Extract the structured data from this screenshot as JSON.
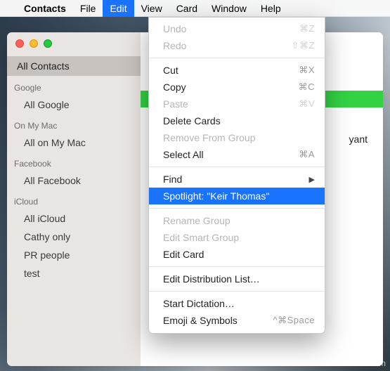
{
  "menubar": {
    "apple": "",
    "app": "Contacts",
    "items": [
      "File",
      "Edit",
      "View",
      "Card",
      "Window",
      "Help"
    ],
    "active_index": 1
  },
  "sidebar": {
    "selected": "All Contacts",
    "groups": [
      {
        "label": "Google",
        "items": [
          "All Google"
        ]
      },
      {
        "label": "On My Mac",
        "items": [
          "All on My Mac"
        ]
      },
      {
        "label": "Facebook",
        "items": [
          "All Facebook"
        ]
      },
      {
        "label": "iCloud",
        "items": [
          "All iCloud",
          "Cathy only",
          "PR people",
          "test"
        ]
      }
    ]
  },
  "content": {
    "visible_fragment": "yant"
  },
  "menu": {
    "rows": [
      {
        "label": "Undo",
        "shortcut": "⌘Z",
        "disabled": true
      },
      {
        "label": "Redo",
        "shortcut": "⇧⌘Z",
        "disabled": true
      },
      {
        "sep": true
      },
      {
        "label": "Cut",
        "shortcut": "⌘X"
      },
      {
        "label": "Copy",
        "shortcut": "⌘C"
      },
      {
        "label": "Paste",
        "shortcut": "⌘V",
        "disabled": true
      },
      {
        "label": "Delete Cards"
      },
      {
        "label": "Remove From Group",
        "disabled": true
      },
      {
        "label": "Select All",
        "shortcut": "⌘A"
      },
      {
        "sep": true
      },
      {
        "label": "Find",
        "submenu": true
      },
      {
        "label": "Spotlight: \"Keir Thomas\"",
        "highlight": true
      },
      {
        "sep": true
      },
      {
        "label": "Rename Group",
        "disabled": true
      },
      {
        "label": "Edit Smart Group",
        "disabled": true
      },
      {
        "label": "Edit Card"
      },
      {
        "sep": true
      },
      {
        "label": "Edit Distribution List…"
      },
      {
        "sep": true
      },
      {
        "label": "Start Dictation…"
      },
      {
        "label": "Emoji & Symbols",
        "shortcut": "^⌘Space"
      }
    ]
  },
  "watermark": "wsxdn.com"
}
